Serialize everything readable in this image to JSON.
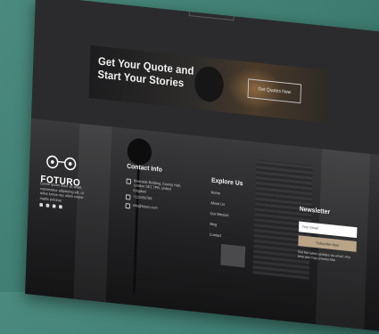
{
  "cta": {
    "title_line1": "Get Your Quote and",
    "title_line2": "Start Your Stories",
    "button_label": "Get Quotes Now"
  },
  "brand": {
    "name": "FOTURO",
    "about": "Lorem ipsum dolor sit amet, consectetur adipiscing elit, ut tellus luctus nec ullam corper mattis pulvinar."
  },
  "contact": {
    "title": "Contact Info",
    "address": "Riverside Building, County Hall, London SE1 7PB, United Kingdom",
    "phone": "+123456789",
    "email": "info@foturo.com"
  },
  "explore": {
    "title": "Explore Us",
    "items": [
      "Home",
      "About Us",
      "Our Mission",
      "Blog",
      "Contact"
    ]
  },
  "newsletter": {
    "title": "Newsletter",
    "email_placeholder": "Your Email",
    "subscribe_label": "Subscribe Now",
    "note": "Get the latest updates via email. Any time you may unsubscribe"
  },
  "colors": {
    "background": "#3f7d72",
    "accent": "#b9a488",
    "dark": "#2a2a2c"
  }
}
